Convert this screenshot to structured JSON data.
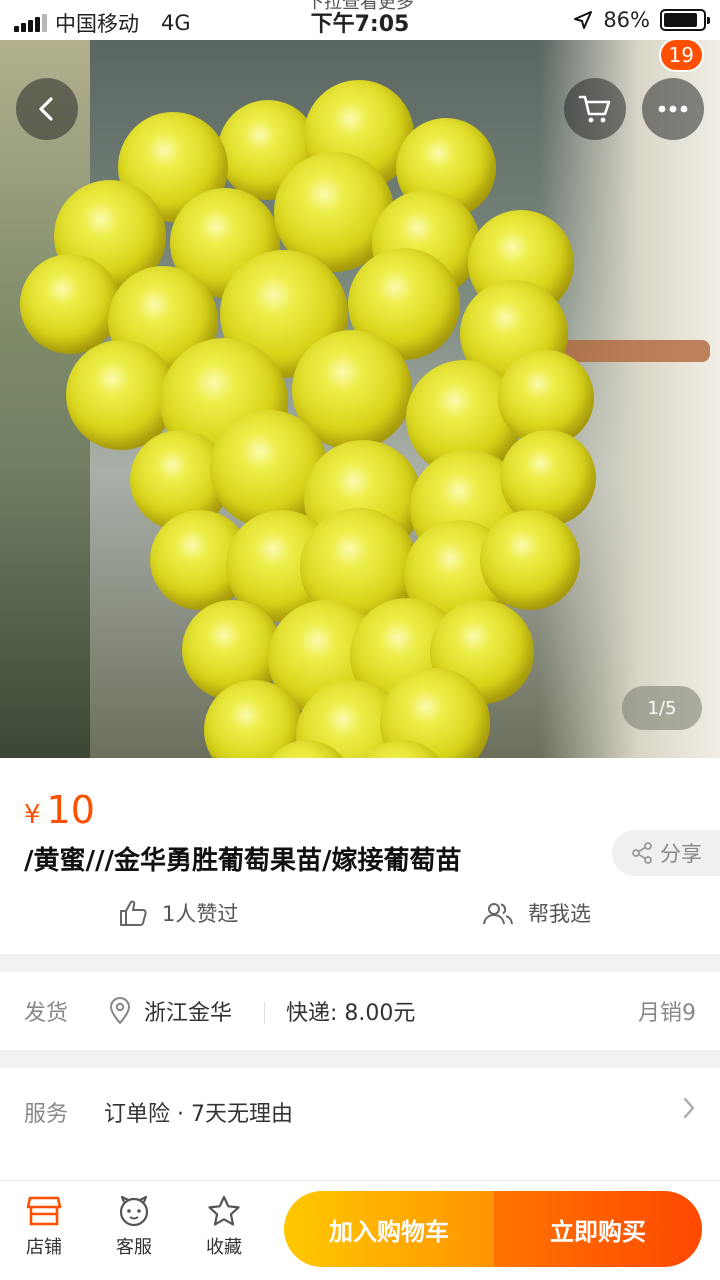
{
  "status_bar": {
    "carrier": "中国移动",
    "network": "4G",
    "time": "下午7:05",
    "hint": "下拉查看更多",
    "battery": "86%",
    "battery_level": 0.86
  },
  "header": {
    "cart_badge": "19"
  },
  "gallery": {
    "indicator": "1/5"
  },
  "product": {
    "price_symbol": "¥",
    "price": "10",
    "title": "/黄蜜///金华勇胜葡萄果苗/嫁接葡萄苗",
    "share_label": "分享",
    "likes_label": "1人赞过",
    "help_choose_label": "帮我选"
  },
  "shipping": {
    "label": "发货",
    "location": "浙江金华",
    "fee": "快递: 8.00元",
    "monthly_sales": "月销9"
  },
  "service": {
    "label": "服务",
    "value": "订单险 · 7天无理由"
  },
  "bottom_bar": {
    "store_label": "店铺",
    "service_label": "客服",
    "favorite_label": "收藏",
    "add_to_cart": "加入购物车",
    "buy_now": "立即购买"
  },
  "colors": {
    "accent": "#ff5000",
    "cart_gradient_start": "#ffc800",
    "buy_gradient_end": "#ff4800"
  }
}
